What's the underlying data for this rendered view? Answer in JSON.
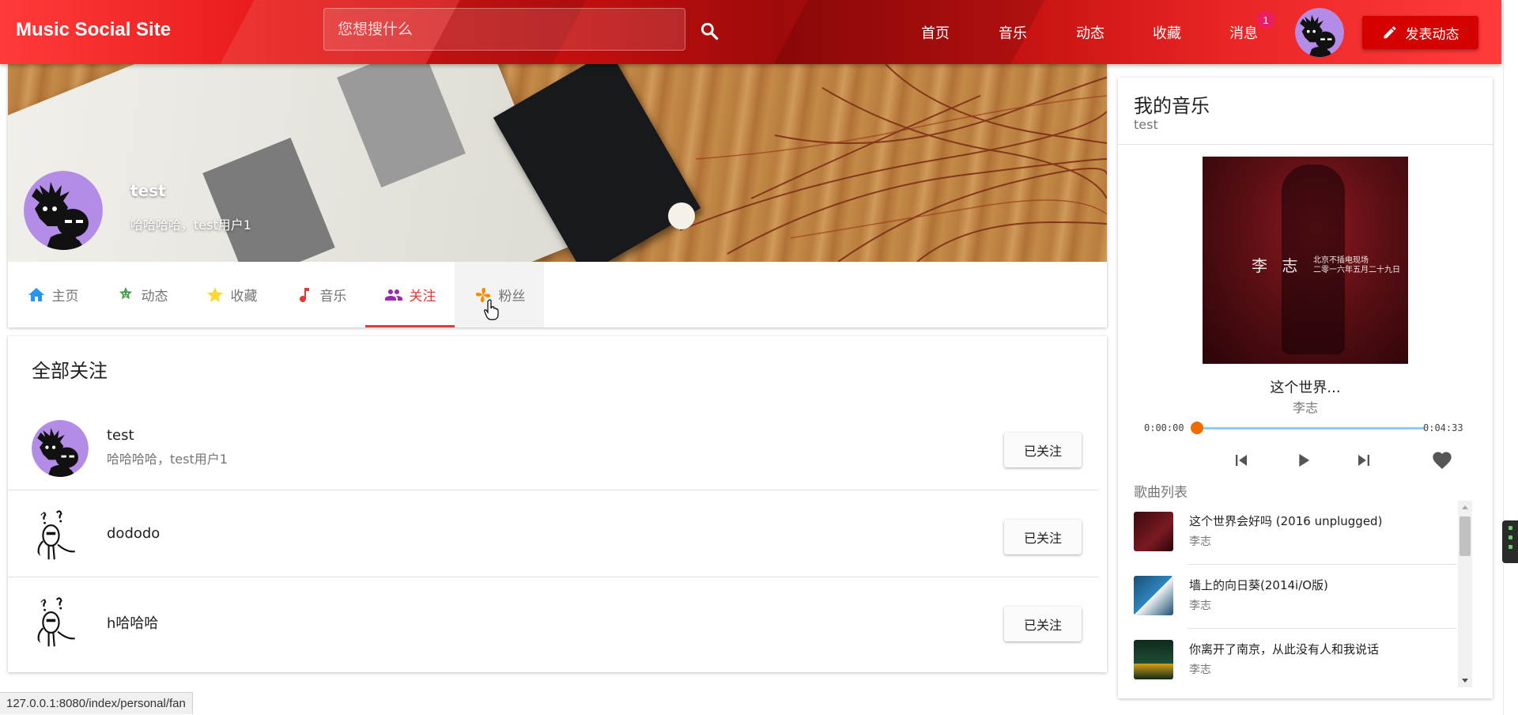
{
  "header": {
    "brand": "Music Social Site",
    "search_placeholder": "您想搜什么",
    "nav": [
      "首页",
      "音乐",
      "动态",
      "收藏",
      "消息"
    ],
    "notification_count": "1",
    "post_button": "发表动态"
  },
  "profile": {
    "name": "test",
    "bio": "哈哈哈哈，test用户1"
  },
  "tabs": [
    {
      "label": "主页",
      "icon": "home-icon",
      "color": "#2196f3"
    },
    {
      "label": "动态",
      "icon": "face-icon",
      "color": "#43a047"
    },
    {
      "label": "收藏",
      "icon": "star-icon",
      "color": "#fdd835"
    },
    {
      "label": "音乐",
      "icon": "music-note-icon",
      "color": "#e53935"
    },
    {
      "label": "关注",
      "icon": "people-icon",
      "color": "#9c27b0"
    },
    {
      "label": "粉丝",
      "icon": "pinwheel-icon",
      "color": "#fb8c00"
    }
  ],
  "active_tab": "关注",
  "follows": {
    "title": "全部关注",
    "items": [
      {
        "name": "test",
        "bio": "哈哈哈哈，test用户1",
        "button": "已关注"
      },
      {
        "name": "dododo",
        "bio": "",
        "button": "已关注"
      },
      {
        "name": "h哈哈哈",
        "bio": "",
        "button": "已关注"
      }
    ]
  },
  "music": {
    "title": "我的音乐",
    "owner": "test",
    "album_text_artist": "李 志",
    "album_text_sub1": "北京不插电现场",
    "album_text_sub2": "二零一六年五月二十九日",
    "current_song": "这个世界...",
    "current_artist": "李志",
    "elapsed": "0:00:00",
    "duration": "0:04:33",
    "progress": 0,
    "playlist_label": "歌曲列表",
    "playlist": [
      {
        "name": "这个世界会好吗 (2016 unplugged)",
        "artist": "李志"
      },
      {
        "name": "墙上的向日葵(2014i/O版)",
        "artist": "李志"
      },
      {
        "name": "你离开了南京，从此没有人和我说话",
        "artist": "李志"
      }
    ]
  },
  "status_url": "127.0.0.1:8080/index/personal/fan",
  "colors": {
    "accent": "#e53935",
    "progress_track": "#90caf9",
    "progress_thumb": "#ef6c00",
    "badge": "#e91e63"
  }
}
